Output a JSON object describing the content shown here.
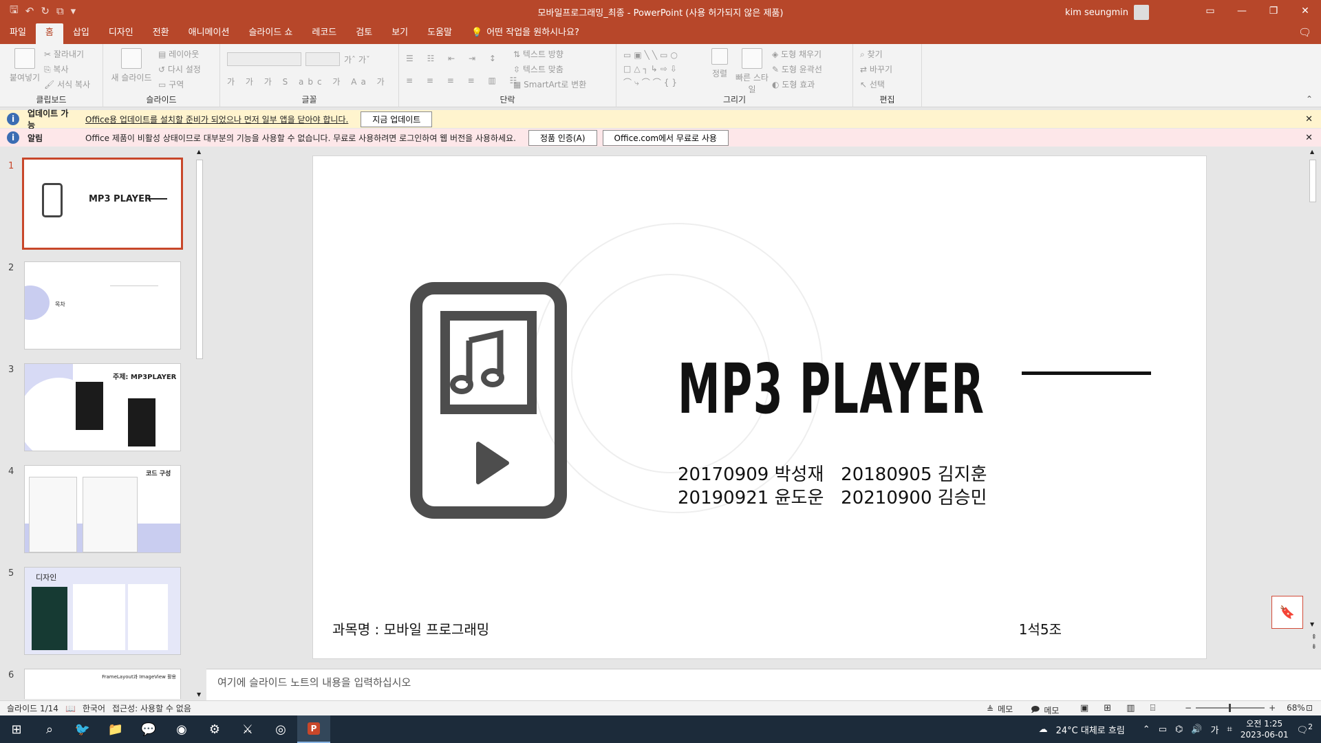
{
  "window": {
    "title": "모바일프로그래밍_최종  -  PowerPoint (사용 허가되지 않은 제품)",
    "user": "kim seungmin"
  },
  "tabs": [
    "파일",
    "홈",
    "삽입",
    "디자인",
    "전환",
    "애니메이션",
    "슬라이드 쇼",
    "레코드",
    "검토",
    "보기",
    "도움말"
  ],
  "tell_me": "어떤 작업을 원하시나요?",
  "ribbon": {
    "clipboard": {
      "label": "클립보드",
      "paste": "붙여넣기",
      "cut": "잘라내기",
      "copy": "복사",
      "format_painter": "서식 복사"
    },
    "slides": {
      "label": "슬라이드",
      "new_slide": "새 슬라이드",
      "layout": "레이아웃",
      "reset": "다시 설정",
      "section": "구역"
    },
    "font": {
      "label": "글꼴"
    },
    "paragraph": {
      "label": "단락",
      "text_direction": "텍스트 방향",
      "align_text": "텍스트 맞춤",
      "smartart": "SmartArt로 변환"
    },
    "drawing": {
      "label": "그리기",
      "arrange": "정렬",
      "quick_styles": "빠른 스타일",
      "shape_fill": "도형 채우기",
      "shape_outline": "도형 윤곽선",
      "shape_effects": "도형 효과"
    },
    "editing": {
      "label": "편집",
      "find": "찾기",
      "replace": "바꾸기",
      "select": "선택"
    }
  },
  "update_bar": {
    "title": "업데이트 가능",
    "message": "Office용 업데이트를 설치할 준비가 되었으나 먼저 일부 앱을 닫아야 합니다.",
    "button": "지금 업데이트"
  },
  "alert_bar": {
    "title": "알림",
    "message": "Office 제품이 비활성 상태이므로 대부분의 기능을 사용할 수 없습니다. 무료로 사용하려면 로그인하여 웹 버전을 사용하세요.",
    "button1": "정품 인증(A)",
    "button2": "Office.com에서 무료로 사용"
  },
  "thumbnails": [
    {
      "num": "1",
      "title": "MP3 PLAYER"
    },
    {
      "num": "2",
      "title": "목차"
    },
    {
      "num": "3",
      "title": "주제: MP3PLAYER"
    },
    {
      "num": "4",
      "title": "코드 구성"
    },
    {
      "num": "5",
      "title": "디자인"
    },
    {
      "num": "6",
      "title": "FrameLayout과 ImageView 활용"
    }
  ],
  "slide": {
    "title": "MP3 PLAYER",
    "names_line1": "20170909 박성재   20180905 김지훈",
    "names_line2": "20190921 윤도운   20210900 김승민",
    "course": "과목명 : 모바일 프로그래밍",
    "group": "1석5조"
  },
  "notes_placeholder": "여기에 슬라이드 노트의 내용을 입력하십시오",
  "status": {
    "slide_count": "슬라이드 1/14",
    "language": "한국어",
    "accessibility": "접근성: 사용할 수 없음",
    "notes": "메모",
    "comments": "메모",
    "zoom": "68%"
  },
  "taskbar": {
    "weather": "24°C  대체로 흐림",
    "time": "오전 1:25",
    "date": "2023-06-01",
    "ime": "가",
    "notif_count": "2"
  },
  "colors": {
    "accent": "#b7472a",
    "update_bar": "#fff4ce",
    "alert_bar": "#fde7e9"
  }
}
